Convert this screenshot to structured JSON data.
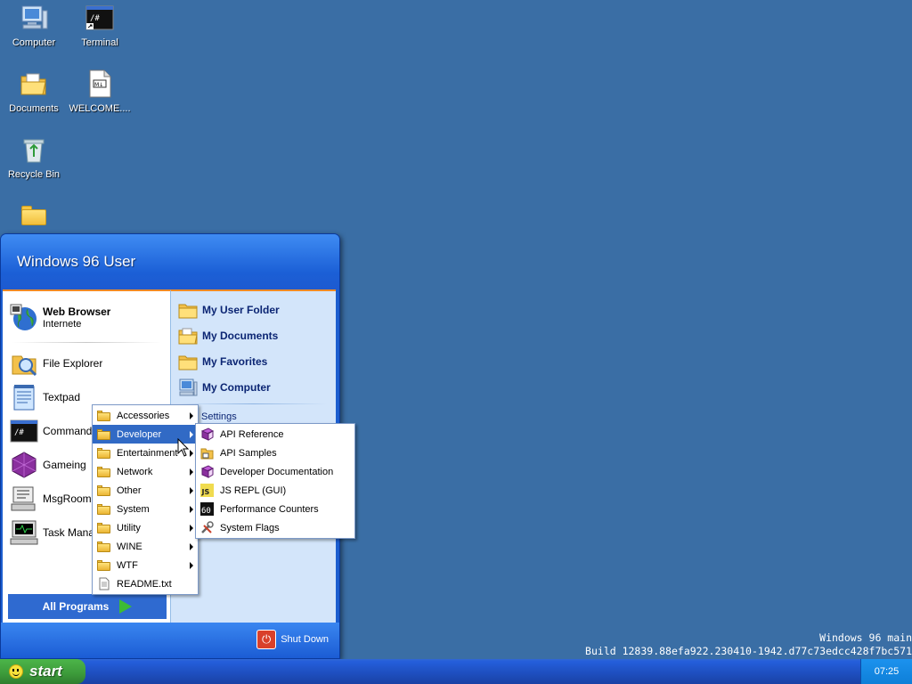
{
  "desktop": {
    "icons": [
      {
        "label": "Computer",
        "icon": "computer-icon"
      },
      {
        "label": "Terminal",
        "icon": "terminal-icon"
      },
      {
        "label": "Documents",
        "icon": "documents-folder-icon"
      },
      {
        "label": "WELCOME....",
        "icon": "markdown-file-icon"
      },
      {
        "label": "Recycle Bin",
        "icon": "recycle-bin-icon"
      },
      {
        "label": "",
        "icon": "folder-icon"
      }
    ]
  },
  "start_menu": {
    "user": "Windows 96 User",
    "pinned": {
      "title": "Web Browser",
      "subtitle": "Internete"
    },
    "programs": [
      {
        "label": "File Explorer",
        "icon": "file-explorer-icon"
      },
      {
        "label": "Textpad",
        "icon": "textpad-icon"
      },
      {
        "label": "Command Li",
        "icon": "command-line-icon"
      },
      {
        "label": "Gameing",
        "icon": "gameing-icon"
      },
      {
        "label": "MsgRoom",
        "icon": "msgroom-icon"
      },
      {
        "label": "Task Manag",
        "icon": "task-manager-icon"
      }
    ],
    "all_programs": "All Programs",
    "places": [
      {
        "label": "My User Folder",
        "icon": "folder-icon"
      },
      {
        "label": "My Documents",
        "icon": "documents-folder-icon"
      },
      {
        "label": "My Favorites",
        "icon": "folder-icon"
      },
      {
        "label": "My Computer",
        "icon": "computer-icon"
      }
    ],
    "settings": "Settings",
    "shutdown": "Shut Down"
  },
  "programs_menu": {
    "items": [
      {
        "label": "Accessories",
        "submenu": true
      },
      {
        "label": "Developer",
        "submenu": true,
        "highlighted": true
      },
      {
        "label": "Entertainment",
        "submenu": true
      },
      {
        "label": "Network",
        "submenu": true
      },
      {
        "label": "Other",
        "submenu": true
      },
      {
        "label": "System",
        "submenu": true
      },
      {
        "label": "Utility",
        "submenu": true
      },
      {
        "label": "WINE",
        "submenu": true
      },
      {
        "label": "WTF",
        "submenu": true
      },
      {
        "label": "README.txt",
        "submenu": false
      }
    ]
  },
  "developer_menu": {
    "items": [
      {
        "label": "API Reference",
        "icon": "book-icon"
      },
      {
        "label": "API Samples",
        "icon": "samples-folder-icon"
      },
      {
        "label": "Developer Documentation",
        "icon": "book-icon"
      },
      {
        "label": "JS REPL (GUI)",
        "icon": "js-icon"
      },
      {
        "label": "Performance Counters",
        "icon": "counter-icon"
      },
      {
        "label": "System Flags",
        "icon": "tools-icon"
      }
    ]
  },
  "taskbar": {
    "start": "start",
    "clock": "07:25"
  },
  "watermark": {
    "line1": "Windows 96 main",
    "line2": "Build 12839.88efa922.230410-1942.d77c73edcc428f7bc571"
  },
  "colors": {
    "desktop": "#3a6ea5",
    "start_green": "#3c9a3a",
    "menu_highlight": "#316ac5",
    "menu_blue": "#1c5ecf"
  }
}
